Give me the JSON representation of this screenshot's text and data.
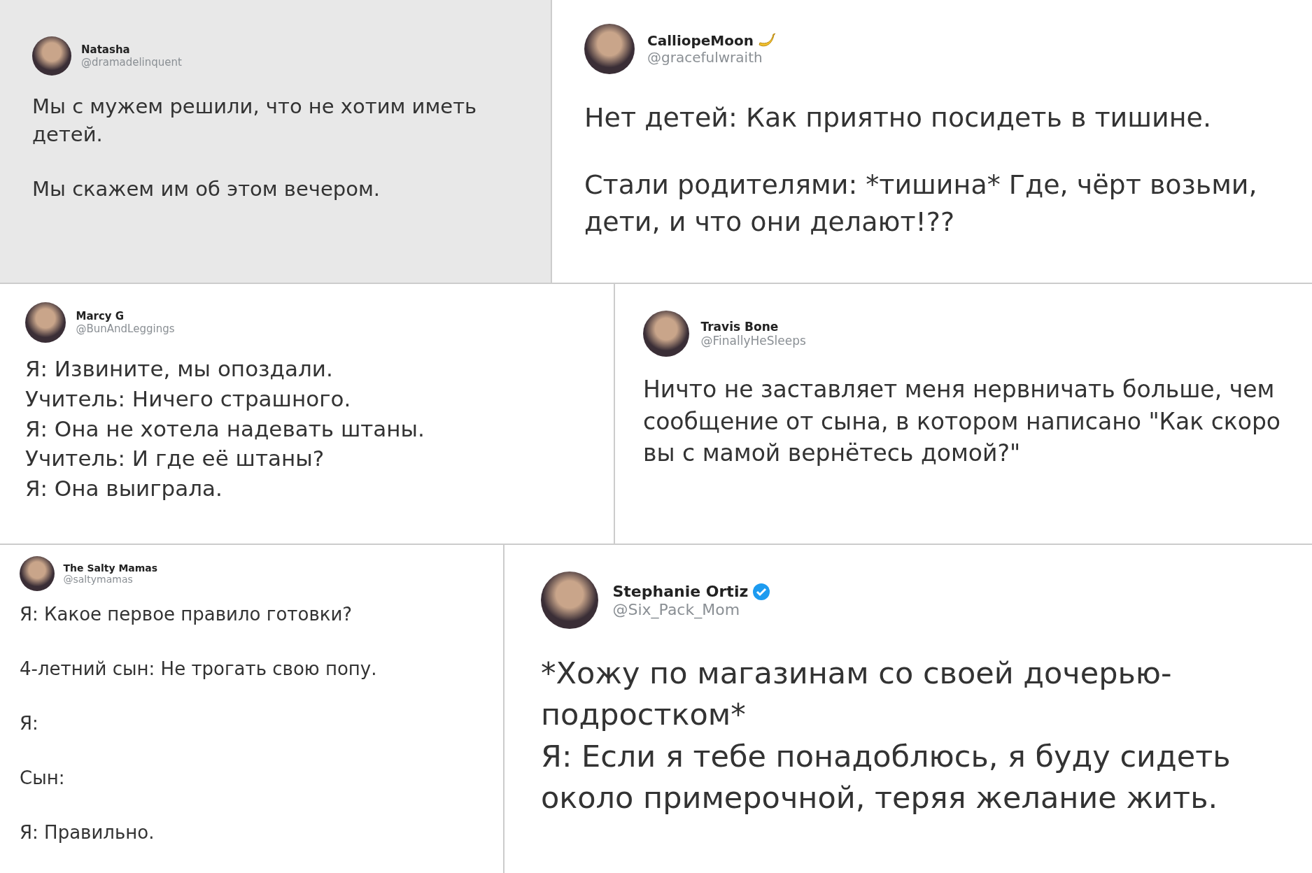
{
  "tweets": [
    {
      "name": "Natasha",
      "handle": "@dramadelinquent",
      "verified": false,
      "paragraphs": [
        "Мы с мужем решили, что не хотим иметь детей.",
        "Мы скажем им об этом вечером."
      ]
    },
    {
      "name": "CalliopeMoon",
      "handle": "@gracefulwraith",
      "verified": false,
      "paragraphs": [
        "Нет детей: Как приятно посидеть в тишине.",
        "Стали родителями: *тишина* Где, чёрт возьми, дети, и что они делают!??"
      ]
    },
    {
      "name": "Marcy G",
      "handle": "@BunAndLeggings",
      "verified": false,
      "paragraphs": [
        "Я: Извините, мы опоздали.",
        "Учитель: Ничего страшного.",
        "Я: Она не хотела надевать штаны.",
        "Учитель: И где её штаны?",
        "Я: Она выиграла."
      ]
    },
    {
      "name": "Travis Bone",
      "handle": "@FinallyHeSleeps",
      "verified": false,
      "paragraphs": [
        "Ничто не заставляет меня нервничать больше, чем сообщение от сына, в котором написано \"Как скоро вы с мамой вернётесь домой?\""
      ]
    },
    {
      "name": "The Salty Mamas",
      "handle": "@saltymamas",
      "verified": false,
      "paragraphs": [
        "Я: Какое первое правило готовки?",
        "4-летний сын: Не трогать свою попу.",
        "Я:",
        "Сын:",
        "Я: Правильно."
      ]
    },
    {
      "name": "Stephanie Ortiz",
      "handle": "@Six_Pack_Mom",
      "verified": true,
      "paragraphs": [
        "*Хожу по магазинам со своей дочерью-подростком*",
        "Я: Если я тебе понадоблюсь, я буду сидеть около примерочной, теряя желание жить."
      ]
    }
  ]
}
